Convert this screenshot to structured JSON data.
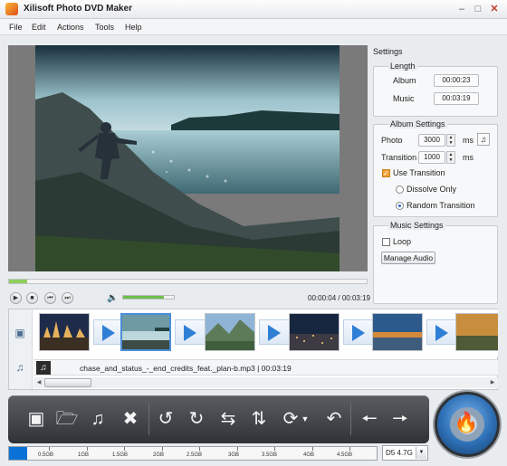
{
  "window": {
    "title": "Xilisoft Photo DVD Maker",
    "minimize_glyph": "–",
    "maximize_glyph": "□",
    "close_glyph": "✕"
  },
  "menu": [
    "File",
    "Edit",
    "Actions",
    "Tools",
    "Help"
  ],
  "player": {
    "current_time": "00:00:04",
    "total_time": "00:03:19",
    "time_separator": "/",
    "seek_progress": 0.05,
    "volume_level": 0.8,
    "volume_icon": "volume-icon"
  },
  "settings": {
    "title": "Settings",
    "length": {
      "title": "Length",
      "album_label": "Album",
      "album_value": "00:00:23",
      "music_label": "Music",
      "music_value": "00:03:19"
    },
    "album_settings": {
      "title": "Album Settings",
      "photo_label": "Photo",
      "photo_value": "3000",
      "photo_unit": "ms",
      "transition_label": "Transition",
      "transition_value": "1000",
      "transition_unit": "ms",
      "use_transition_label": "Use Transition",
      "use_transition_checked": true,
      "dissolve_only_label": "Dissolve Only",
      "random_transition_label": "Random Transition",
      "selected_mode": "Random Transition"
    },
    "music_settings": {
      "title": "Music Settings",
      "loop_label": "Loop",
      "loop_checked": false,
      "manage_audio_label": "Manage Audio"
    }
  },
  "storyboard": {
    "selected_index": 1,
    "photo_count": 6,
    "music_track": "chase_and_status_-_end_credits_feat._plan-b.mp3 | 00:03:19"
  },
  "toolbar": {
    "tools": [
      "add-photo-icon",
      "add-folder-icon",
      "add-music-icon",
      "delete-icon",
      "rotate-left-icon",
      "rotate-right-icon",
      "flip-horizontal-icon",
      "flip-vertical-icon",
      "transition-effect-icon",
      "undo-icon",
      "move-left-icon",
      "move-right-icon"
    ]
  },
  "disc": {
    "ticks": [
      "0.5GB",
      "1GB",
      "1.5GB",
      "2GB",
      "2.5GB",
      "3GB",
      "3.5GB",
      "4GB",
      "4.5GB"
    ],
    "used_fraction": 0.05,
    "selected_type": "D5 4.7G",
    "colors": {
      "used": "#0a72d6",
      "accent": "#f3a33a"
    }
  }
}
